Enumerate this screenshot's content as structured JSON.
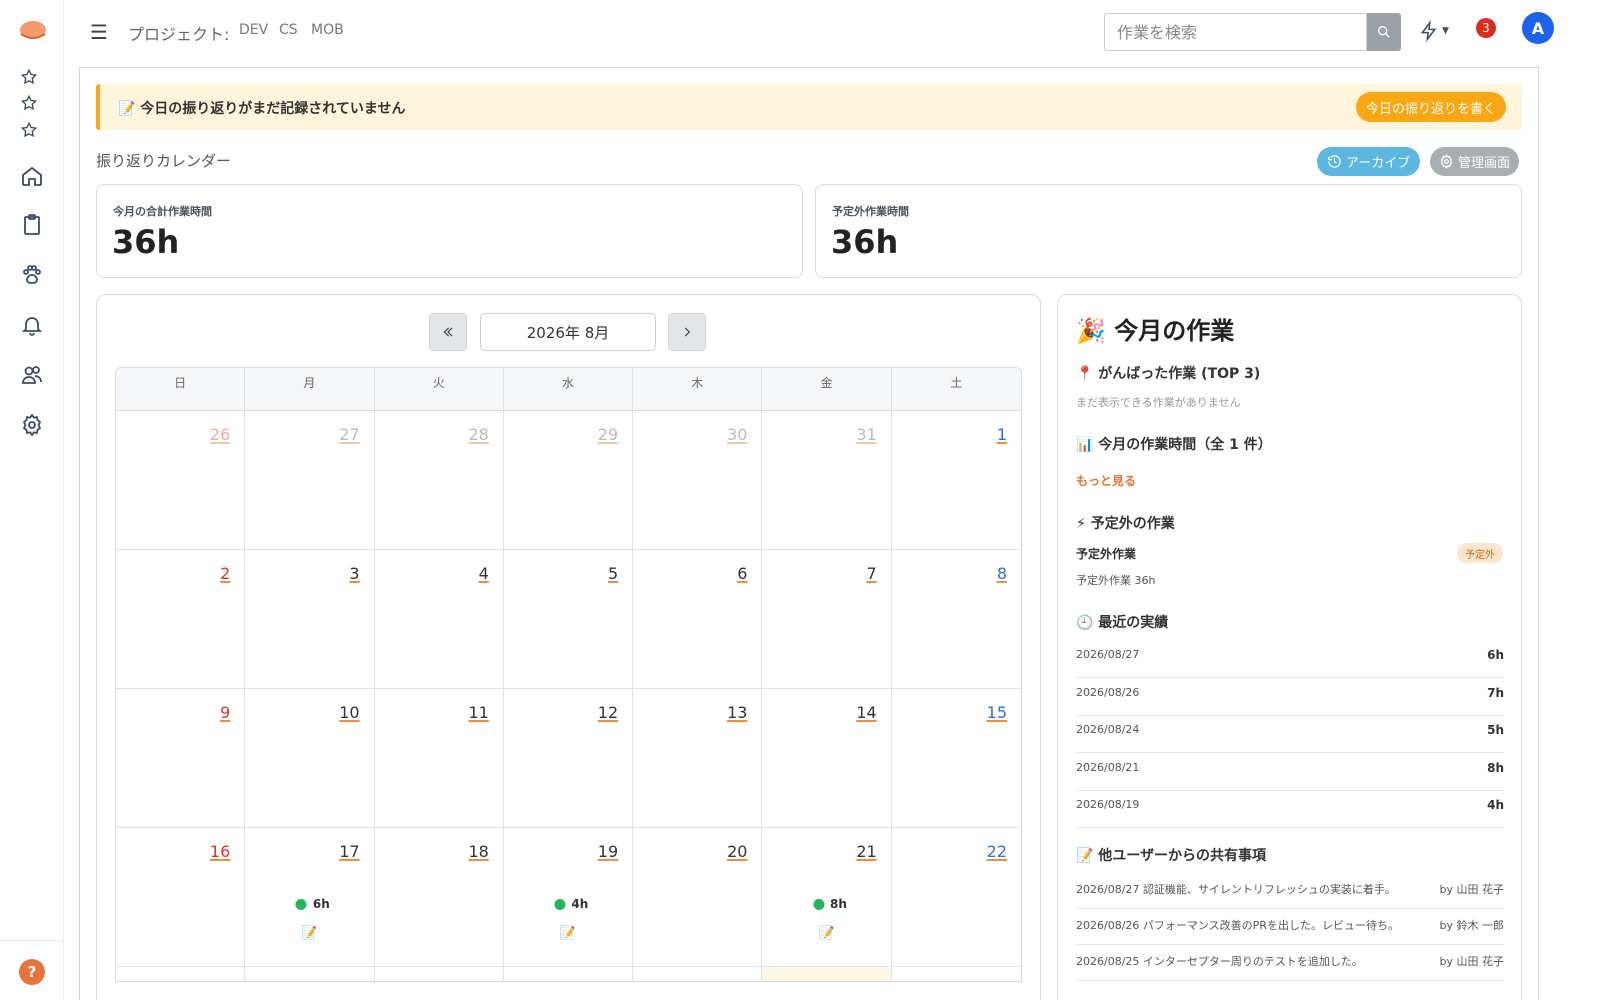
{
  "header": {
    "menu_icon": "hamburger-icon",
    "project_label": "プロジェクト:",
    "projects": [
      "DEV",
      "CS",
      "MOB"
    ],
    "search_placeholder": "作業を検索",
    "notification_count": "3",
    "avatar_initial": "A"
  },
  "sidebar": {
    "favorites": [
      "star-icon",
      "star-icon",
      "star-icon"
    ],
    "nav": [
      "home-icon",
      "clipboard-icon",
      "paw-icon",
      "bell-icon",
      "users-icon",
      "gear-icon"
    ],
    "help": "?"
  },
  "banner": {
    "text": "📝 今日の振り返りがまだ記録されていません",
    "button": "今日の振り返りを書く"
  },
  "page": {
    "title": "振り返りカレンダー",
    "archive_button": "アーカイブ",
    "admin_button": "管理画面"
  },
  "stats": [
    {
      "label": "今月の合計作業時間",
      "value": "36h"
    },
    {
      "label": "予定外作業時間",
      "value": "36h"
    }
  ],
  "calendar": {
    "month_label": "2026年 8月",
    "weekdays": [
      "日",
      "月",
      "火",
      "水",
      "木",
      "金",
      "土"
    ],
    "weeks": [
      [
        {
          "d": "26",
          "m": true
        },
        {
          "d": "27",
          "m": true
        },
        {
          "d": "28",
          "m": true
        },
        {
          "d": "29",
          "m": true
        },
        {
          "d": "30",
          "m": true
        },
        {
          "d": "31",
          "m": true
        },
        {
          "d": "1"
        }
      ],
      [
        {
          "d": "2"
        },
        {
          "d": "3"
        },
        {
          "d": "4"
        },
        {
          "d": "5"
        },
        {
          "d": "6"
        },
        {
          "d": "7"
        },
        {
          "d": "8"
        }
      ],
      [
        {
          "d": "9"
        },
        {
          "d": "10"
        },
        {
          "d": "11"
        },
        {
          "d": "12"
        },
        {
          "d": "13"
        },
        {
          "d": "14"
        },
        {
          "d": "15"
        }
      ],
      [
        {
          "d": "16"
        },
        {
          "d": "17",
          "h": "6h",
          "memo": "📝"
        },
        {
          "d": "18"
        },
        {
          "d": "19",
          "h": "4h",
          "memo": "📝"
        },
        {
          "d": "20"
        },
        {
          "d": "21",
          "h": "8h",
          "memo": "📝"
        },
        {
          "d": "22"
        }
      ]
    ]
  },
  "summary": {
    "title": "🎉 今月の作業",
    "top3_title": "📍 がんばった作業 (TOP 3)",
    "top3_empty": "まだ表示できる作業がありません",
    "hours_title": "📊 今月の作業時間（全 1 件）",
    "more_link": "もっと見る",
    "unplanned_title": "⚡ 予定外の作業",
    "unplanned_name": "予定外作業",
    "unplanned_badge": "予定外",
    "unplanned_desc": "予定外作業 36h",
    "recent_title": "🕘 最近の実績",
    "recent": [
      {
        "date": "2026/08/27",
        "hours": "6h"
      },
      {
        "date": "2026/08/26",
        "hours": "7h"
      },
      {
        "date": "2026/08/24",
        "hours": "5h"
      },
      {
        "date": "2026/08/21",
        "hours": "8h"
      },
      {
        "date": "2026/08/19",
        "hours": "4h"
      }
    ],
    "shared_title": "📝 他ユーザーからの共有事項",
    "shared": [
      {
        "text": "2026/08/27 認証機能、サイレントリフレッシュの実装に着手。",
        "by": "by 山田 花子"
      },
      {
        "text": "2026/08/26 パフォーマンス改善のPRを出した。レビュー待ち。",
        "by": "by 鈴木 一郎"
      },
      {
        "text": "2026/08/25 インターセプター周りのテストを追加した。",
        "by": "by 山田 花子"
      }
    ]
  }
}
